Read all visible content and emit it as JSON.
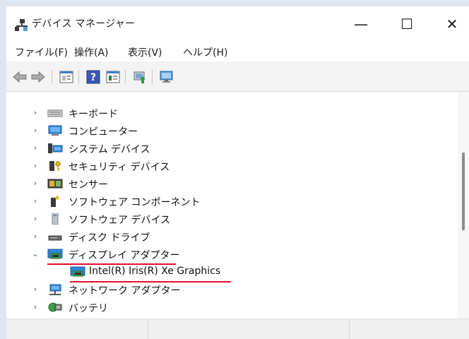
{
  "window": {
    "title": "デバイス マネージャー",
    "controls": {
      "minimize": "—",
      "maximize": "☐",
      "close": "✕"
    }
  },
  "menu": {
    "items": [
      "ファイル(F)",
      "操作(A)",
      "表示(V)",
      "ヘルプ(H)"
    ]
  },
  "toolbar": {
    "buttons": [
      {
        "icon": "back-arrow-icon"
      },
      {
        "icon": "forward-arrow-icon"
      },
      {
        "icon": "properties-icon"
      },
      {
        "icon": "help-icon",
        "text": "?"
      },
      {
        "icon": "view-icon"
      },
      {
        "icon": "update-driver-icon"
      },
      {
        "icon": "scan-hardware-icon"
      }
    ]
  },
  "tree": {
    "items": [
      {
        "label": "キーボード",
        "icon": "keyboard-icon",
        "expanded": false
      },
      {
        "label": "コンピューター",
        "icon": "computer-icon",
        "expanded": false
      },
      {
        "label": "システム デバイス",
        "icon": "system-device-icon",
        "expanded": false
      },
      {
        "label": "セキュリティ デバイス",
        "icon": "security-device-icon",
        "expanded": false
      },
      {
        "label": "センサー",
        "icon": "sensor-icon",
        "expanded": false
      },
      {
        "label": "ソフトウェア コンポーネント",
        "icon": "software-component-icon",
        "expanded": false
      },
      {
        "label": "ソフトウェア デバイス",
        "icon": "software-device-icon",
        "expanded": false
      },
      {
        "label": "ディスク ドライブ",
        "icon": "disk-drive-icon",
        "expanded": false
      },
      {
        "label": "ディスプレイ アダプター",
        "icon": "display-adapter-icon",
        "expanded": true
      },
      {
        "label": "Intel(R) Iris(R) Xe Graphics",
        "icon": "display-adapter-icon",
        "child": true
      },
      {
        "label": "ネットワーク アダプター",
        "icon": "network-adapter-icon",
        "expanded": false
      },
      {
        "label": "バッテリ",
        "icon": "battery-icon",
        "expanded": false
      }
    ]
  },
  "highlight_color": "#e3102b"
}
